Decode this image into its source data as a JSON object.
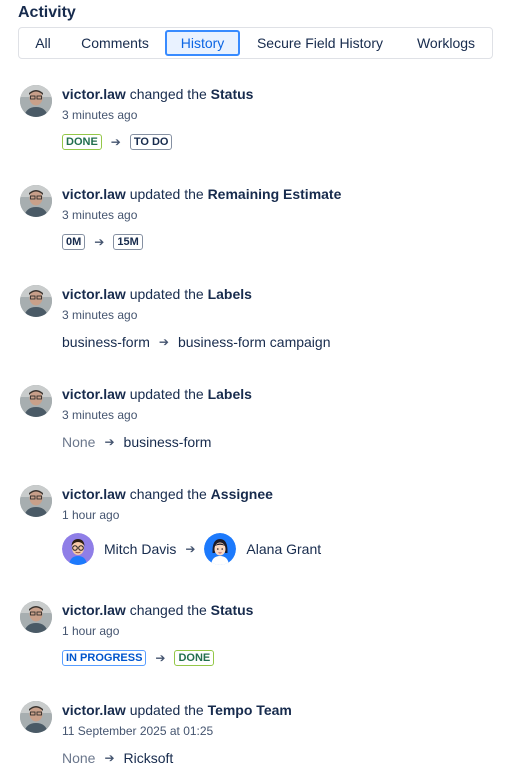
{
  "header": {
    "title": "Activity"
  },
  "tabs": [
    {
      "label": "All",
      "active": false
    },
    {
      "label": "Comments",
      "active": false
    },
    {
      "label": "History",
      "active": true
    },
    {
      "label": "Secure Field History",
      "active": false
    },
    {
      "label": "Worklogs",
      "active": false
    }
  ],
  "entries": [
    {
      "user": "victor.law",
      "action": "changed the",
      "field": "Status",
      "time": "3 minutes ago",
      "from": "DONE",
      "to": "TO DO"
    },
    {
      "user": "victor.law",
      "action": "updated the",
      "field": "Remaining Estimate",
      "time": "3 minutes ago",
      "from": "0M",
      "to": "15M"
    },
    {
      "user": "victor.law",
      "action": "updated the",
      "field": "Labels",
      "time": "3 minutes ago",
      "from": "business-form",
      "to": "business-form campaign"
    },
    {
      "user": "victor.law",
      "action": "updated the",
      "field": "Labels",
      "time": "3 minutes ago",
      "from": "None",
      "to": "business-form"
    },
    {
      "user": "victor.law",
      "action": "changed the",
      "field": "Assignee",
      "time": "1 hour ago",
      "from": "Mitch Davis",
      "to": "Alana Grant"
    },
    {
      "user": "victor.law",
      "action": "changed the",
      "field": "Status",
      "time": "1 hour ago",
      "from": "IN PROGRESS",
      "to": "DONE"
    },
    {
      "user": "victor.law",
      "action": "updated the",
      "field": "Tempo Team",
      "time": "11 September 2025 at 01:25",
      "from": "None",
      "to": "Ricksoft"
    }
  ],
  "icons": {
    "arrow": "arrow-right-icon",
    "user_avatar": "user-avatar-icon"
  },
  "colors": {
    "accent": "#0c66e4",
    "done": "#94c748",
    "in_progress": "#579dff"
  }
}
